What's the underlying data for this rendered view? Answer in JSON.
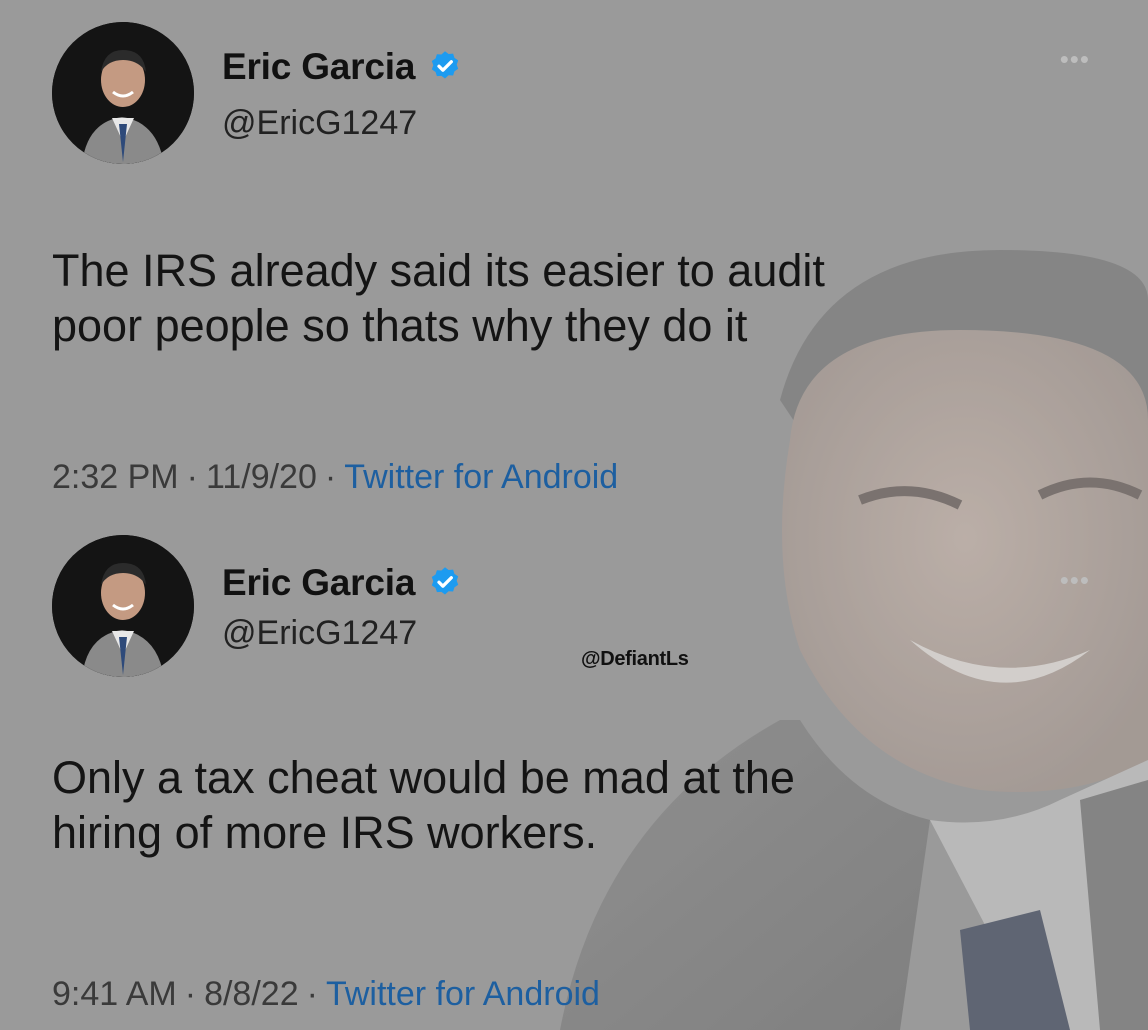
{
  "tweets": [
    {
      "display_name": "Eric Garcia",
      "handle": "@EricG1247",
      "more_label": "•••",
      "text_lines": [
        "The IRS already said its easier to audit",
        "poor people so thats why they do it"
      ],
      "time": "2:32 PM",
      "date": "11/9/20",
      "source": "Twitter for Android",
      "separator": "·"
    },
    {
      "display_name": "Eric Garcia",
      "handle": "@EricG1247",
      "more_label": "•••",
      "text_lines": [
        "Only a tax cheat would be mad at the",
        "hiring of more IRS workers."
      ],
      "time": "9:41 AM",
      "date": "8/8/22",
      "source": "Twitter for Android",
      "separator": "·"
    }
  ],
  "watermark": "@DefiantLs",
  "colors": {
    "verified": "#1d9bf0",
    "source_link": "#1d5fa0",
    "background": "#9a9a9a"
  },
  "icons": {
    "verified": "verified-badge-icon",
    "more": "more-dots-icon"
  }
}
